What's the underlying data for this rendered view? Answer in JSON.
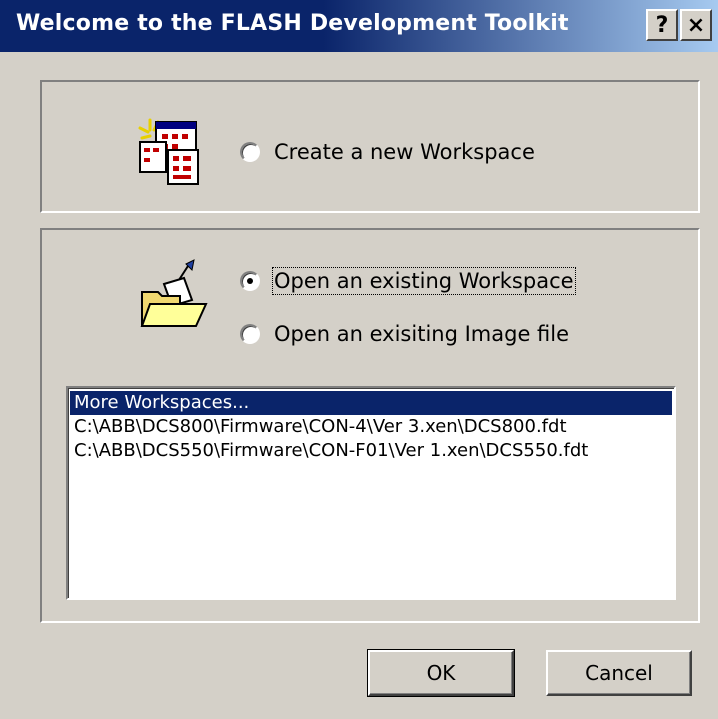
{
  "window": {
    "title": "Welcome to the FLASH Development Toolkit",
    "help_label": "?",
    "close_label": "×"
  },
  "create_group": {
    "radio_label": "Create a new Workspace",
    "checked": false,
    "icon": "new-workspace-icon"
  },
  "open_group": {
    "icon": "open-folder-icon",
    "options": [
      {
        "label": "Open an existing Workspace",
        "checked": true
      },
      {
        "label": "Open an exisiting Image file",
        "checked": false
      }
    ],
    "workspaces": [
      "More Workspaces...",
      "C:\\ABB\\DCS800\\Firmware\\CON-4\\Ver 3.xen\\DCS800.fdt",
      "C:\\ABB\\DCS550\\Firmware\\CON-F01\\Ver 1.xen\\DCS550.fdt"
    ],
    "selected_index": 0
  },
  "buttons": {
    "ok": "OK",
    "cancel": "Cancel"
  },
  "colors": {
    "title_bar": "#0a246a",
    "dialog_bg": "#d4d0c8",
    "selection": "#0a246a"
  }
}
